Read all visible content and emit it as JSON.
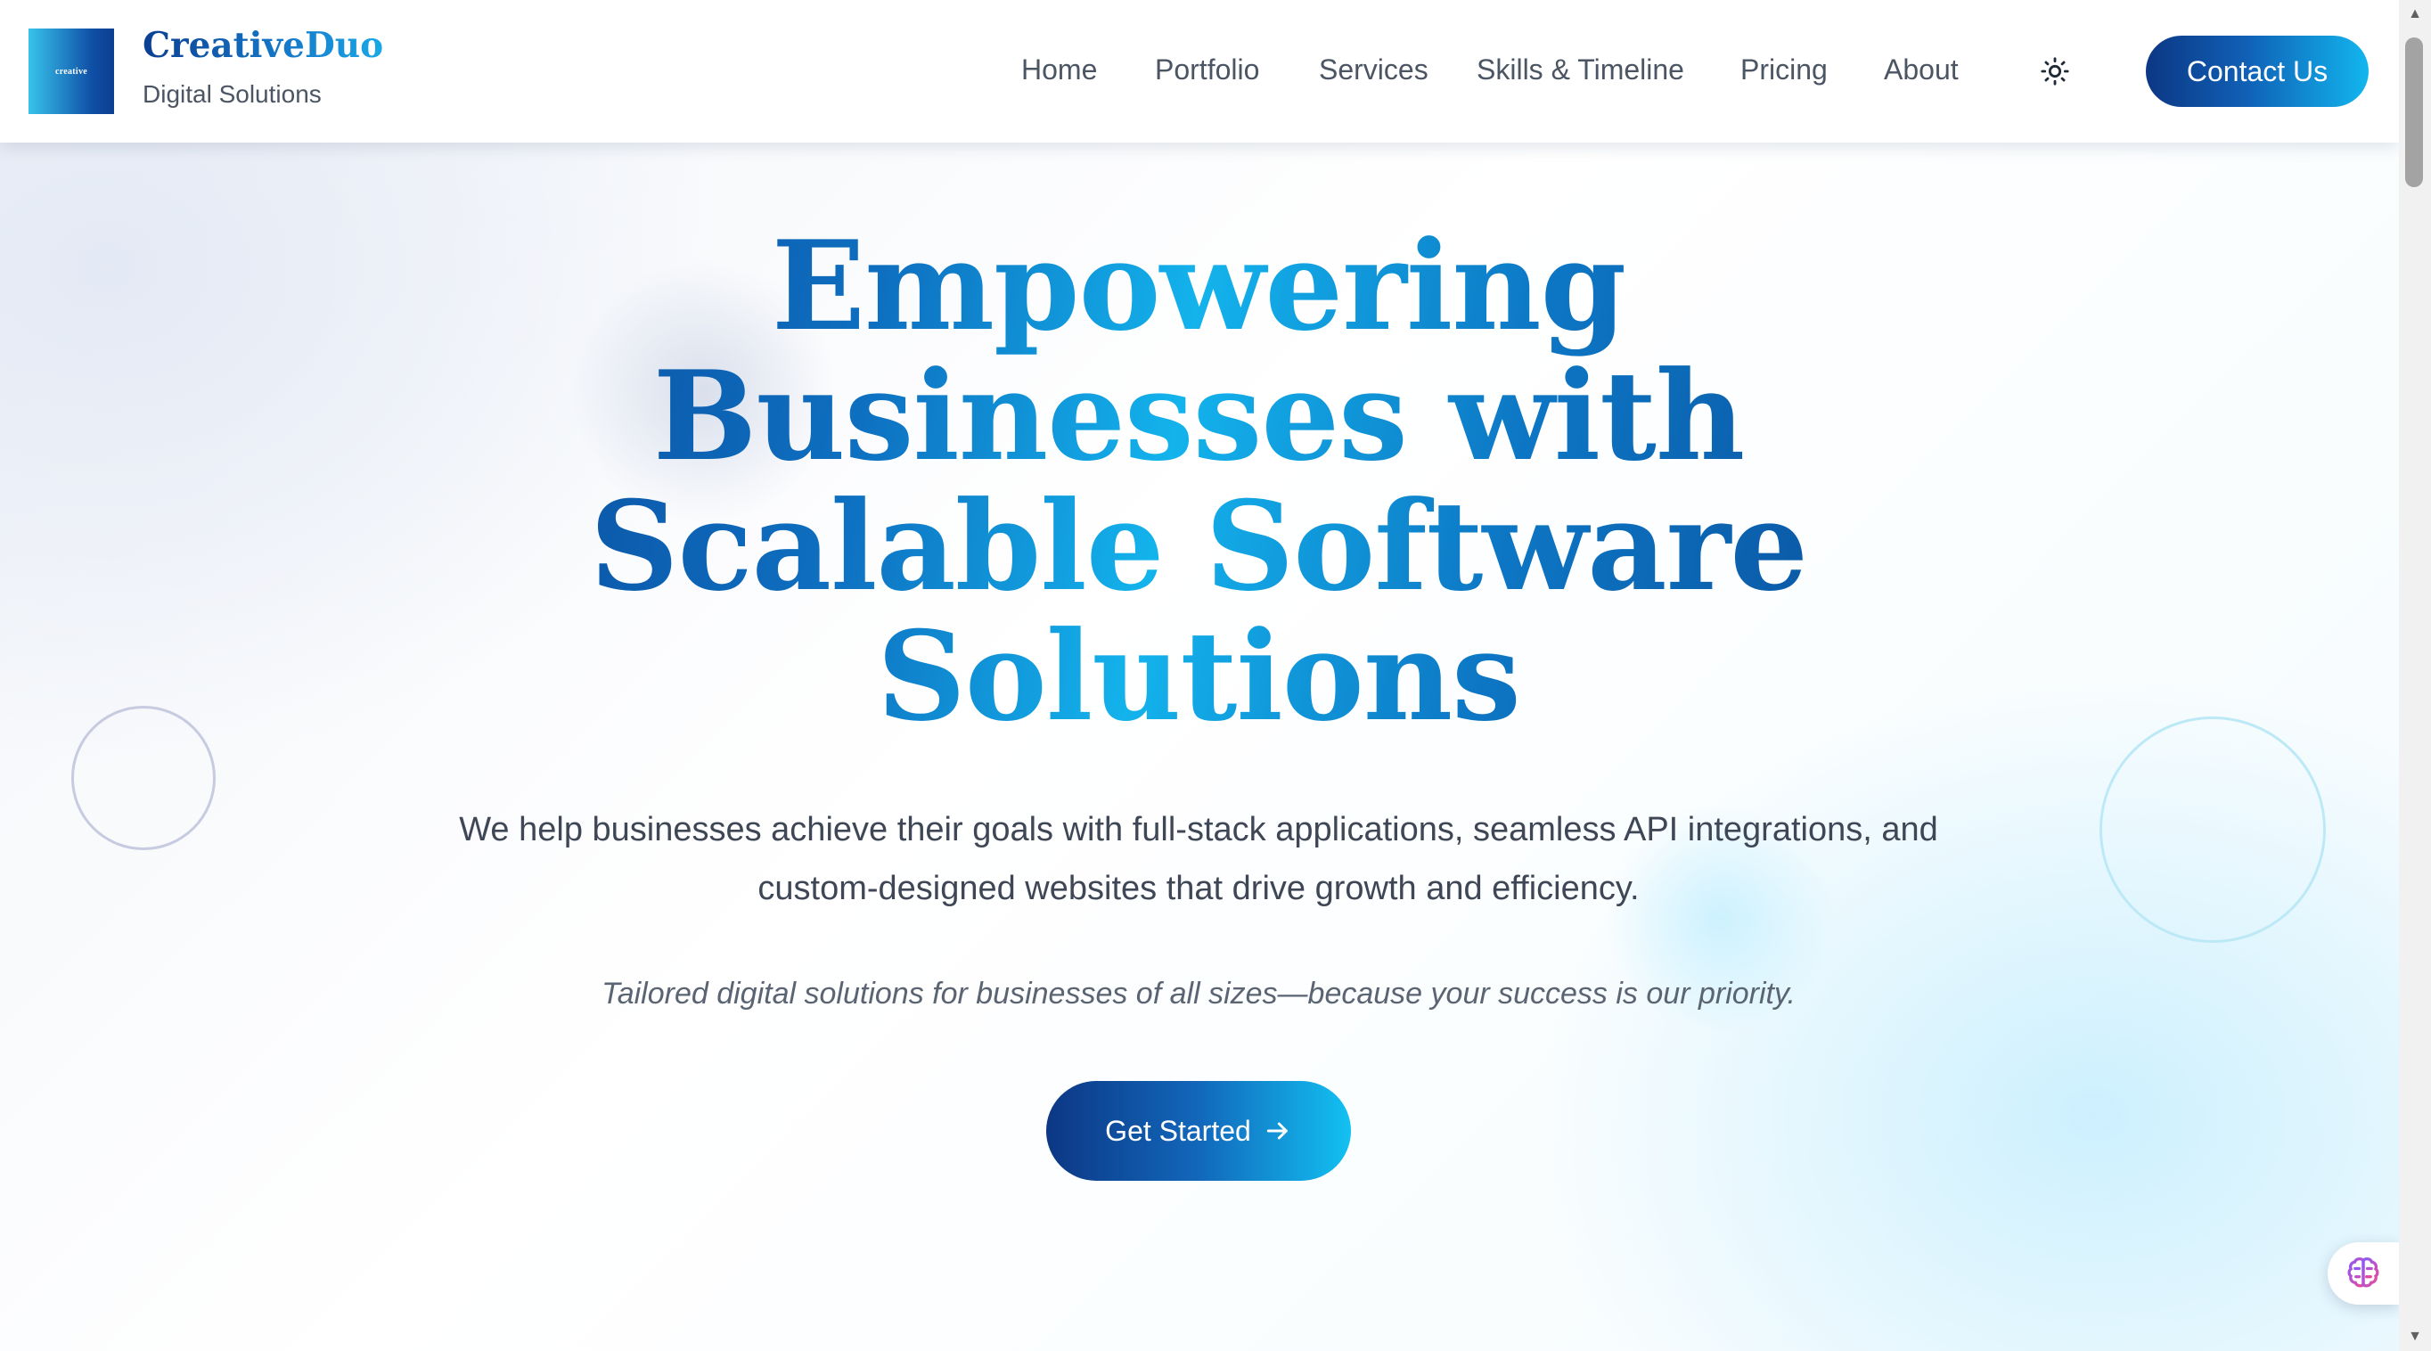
{
  "brand": {
    "logo_text": "creative",
    "name": "CreativeDuo",
    "tagline": "Digital Solutions"
  },
  "nav": {
    "items": [
      {
        "label": "Home"
      },
      {
        "label": "Portfolio"
      },
      {
        "label": "Services"
      },
      {
        "label": "Skills & Timeline"
      },
      {
        "label": "Pricing"
      },
      {
        "label": "About"
      }
    ],
    "theme_icon": "sun-icon",
    "contact_label": "Contact Us"
  },
  "hero": {
    "title_lines": [
      "Empowering",
      "Businesses with",
      "Scalable Software",
      "Solutions"
    ],
    "description_lines": [
      "We help businesses achieve their goals with full-stack applications, seamless API integrations, and",
      "custom-designed websites that drive growth and efficiency."
    ],
    "tagline": "Tailored digital solutions for businesses of all sizes—because your success is our priority.",
    "cta_label": "Get Started",
    "cta_icon": "arrow-right-icon"
  },
  "widgets": {
    "assistant_icon": "brain-icon"
  },
  "colors": {
    "primary_dark": "#0c3784",
    "primary_light": "#12c1f2",
    "text_body": "#3f4756",
    "text_muted": "#4b5563"
  }
}
